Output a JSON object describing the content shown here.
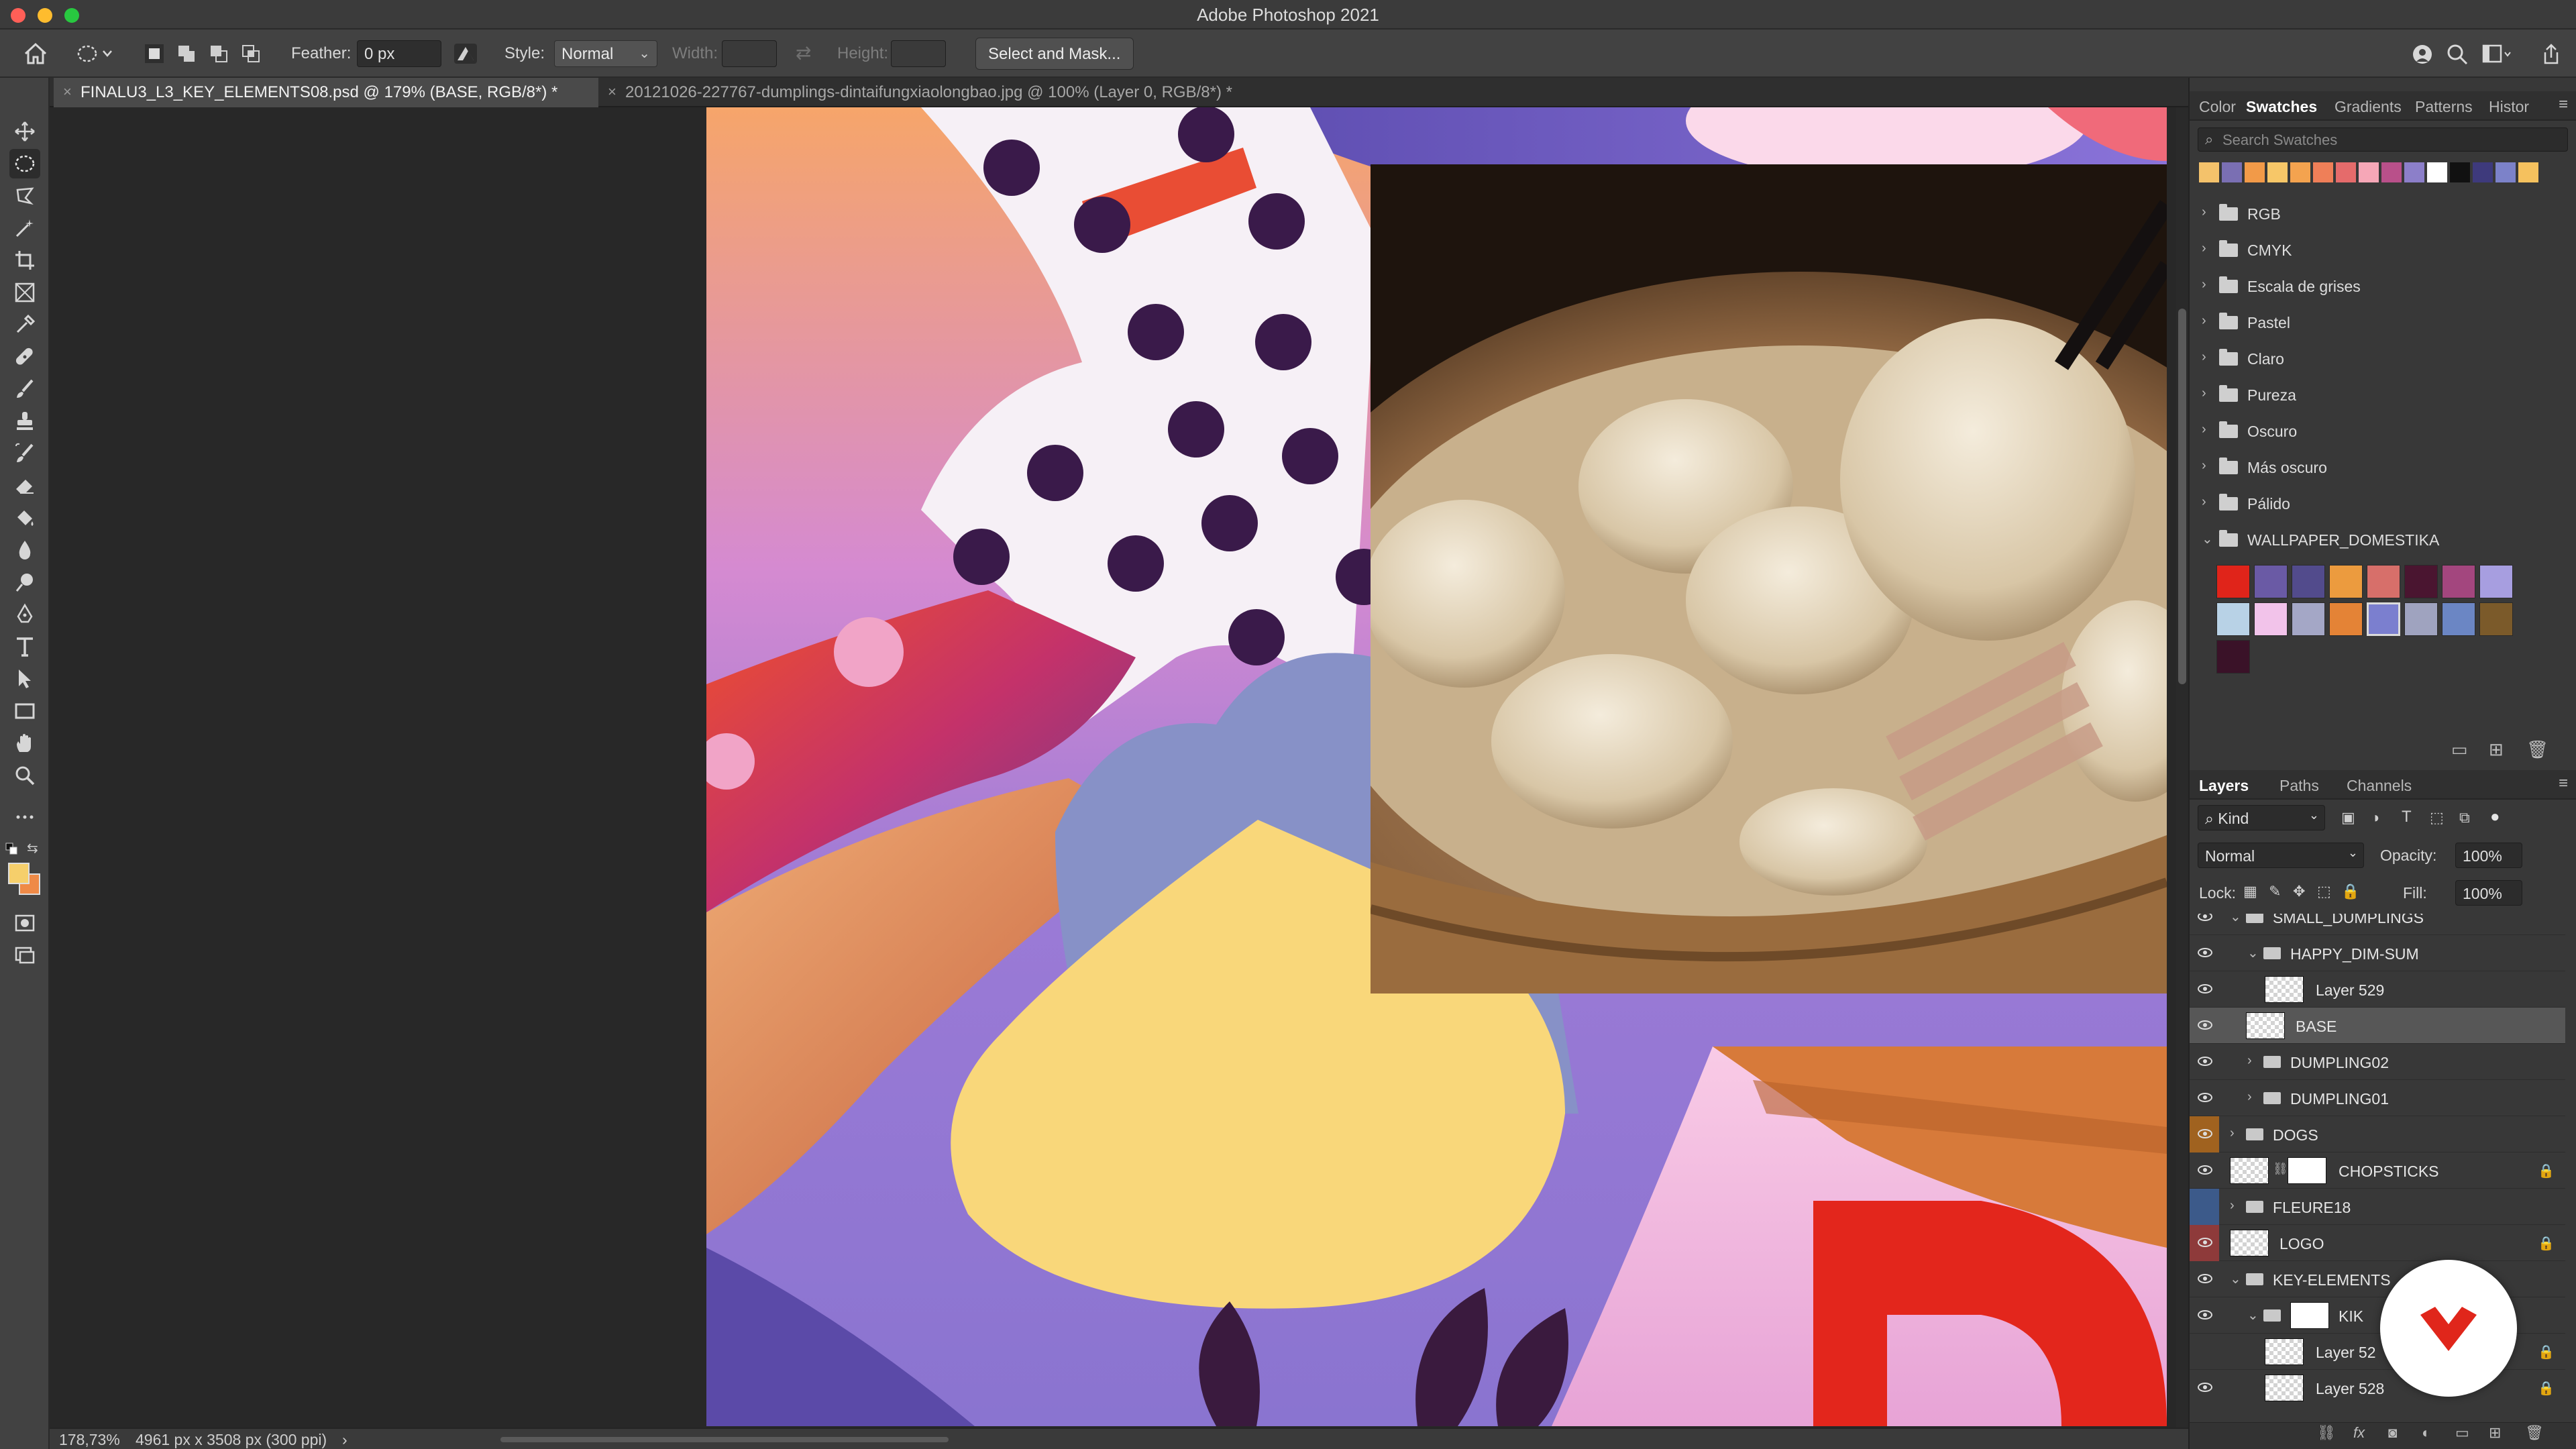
{
  "app": {
    "title": "Adobe Photoshop 2021"
  },
  "options_bar": {
    "feather_label": "Feather:",
    "feather_value": "0 px",
    "style_label": "Style:",
    "style_value": "Normal",
    "width_label": "Width:",
    "height_label": "Height:",
    "select_mask_label": "Select and Mask..."
  },
  "tabs": [
    {
      "label": "FINALU3_L3_KEY_ELEMENTS08.psd @ 179% (BASE, RGB/8*) *",
      "active": true
    },
    {
      "label": "20121026-227767-dumplings-dintaifungxiaolongbao.jpg @ 100% (Layer 0, RGB/8*) *",
      "active": false
    }
  ],
  "status": {
    "zoom": "178,73%",
    "doc_size": "4961 px x 3508 px (300 ppi)",
    "arrow": "›"
  },
  "swatches_panel": {
    "tabs": [
      "Color",
      "Swatches",
      "Gradients",
      "Patterns",
      "Histor"
    ],
    "active_tab": "Swatches",
    "search_placeholder": "Search Swatches",
    "recent_colors": [
      "#f4c26b",
      "#7a6fb3",
      "#f29a48",
      "#f7c768",
      "#f4a34f",
      "#ef7f58",
      "#e56b6b",
      "#f6a7b7",
      "#b9508a",
      "#8c7fc9",
      "#ffffff",
      "#111111",
      "#3e3a7c",
      "#7c82c9",
      "#f5c15e"
    ],
    "groups": [
      "RGB",
      "CMYK",
      "Escala de grises",
      "Pastel",
      "Claro",
      "Pureza",
      "Oscuro",
      "Más oscuro",
      "Pálido",
      "WALLPAPER_DOMESTIKA"
    ],
    "wallpaper_colors": [
      "#e0241a",
      "#6a5aa5",
      "#524b8c",
      "#ec9b3e",
      "#d76f6a",
      "#4a1530",
      "#a3467e",
      "#a79ee0",
      "#b8d2e6",
      "#f2c3ea",
      "#a4a7c6",
      "#e48336",
      "#7b7fcf",
      "#9fa3bf",
      "#6b86c4",
      "#7b5a2a",
      "#3a1228"
    ]
  },
  "layers_panel": {
    "tabs": [
      "Layers",
      "Paths",
      "Channels"
    ],
    "active_tab": "Layers",
    "filter_value": "Kind",
    "blend_mode": "Normal",
    "opacity_label": "Opacity:",
    "opacity_value": "100%",
    "lock_label": "Lock:",
    "fill_label": "Fill:",
    "fill_value": "100%",
    "layers": [
      {
        "name": "SMALL_DUMPLINGS",
        "type": "group"
      },
      {
        "name": "HAPPY_DIM-SUM",
        "type": "group"
      },
      {
        "name": "Layer 529",
        "type": "pixel"
      },
      {
        "name": "BASE",
        "type": "pixel",
        "selected": true
      },
      {
        "name": "DUMPLING02",
        "type": "group"
      },
      {
        "name": "DUMPLING01",
        "type": "group"
      },
      {
        "name": "DOGS",
        "type": "group",
        "color": "#a0621f"
      },
      {
        "name": "CHOPSTICKS",
        "type": "masked",
        "locked": true
      },
      {
        "name": "FLEURE18",
        "type": "group",
        "color": "#3c5a8a"
      },
      {
        "name": "LOGO",
        "type": "pixel",
        "color": "#8e3a3a",
        "locked": true
      },
      {
        "name": "KEY-ELEMENTS",
        "type": "group"
      },
      {
        "name": "KIK",
        "type": "group"
      },
      {
        "name": "Layer 52",
        "type": "pixel",
        "locked": true
      },
      {
        "name": "Layer 528",
        "type": "pixel",
        "locked": true
      }
    ]
  },
  "colors": {
    "foreground": "#f6cf6b",
    "background": "#ef8a47",
    "accent_badge": "#e0261b"
  }
}
